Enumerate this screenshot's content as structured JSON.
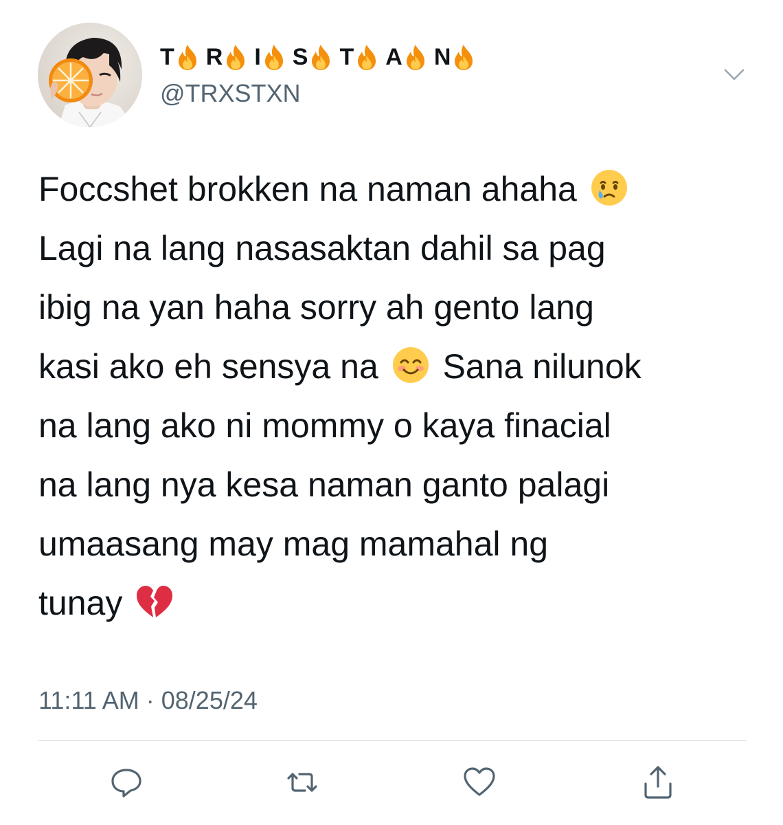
{
  "author": {
    "name_letters": [
      "T",
      "R",
      "I",
      "S",
      "T",
      "A",
      "N"
    ],
    "name_decoration_icon": "fire-icon",
    "handle": "@TRXSTXN",
    "avatar_icon": "avatar-photo"
  },
  "menu": {
    "icon": "chevron-down-icon"
  },
  "tweet": {
    "lines": [
      {
        "segments": [
          {
            "text": "Foccshet brokken na naman ahaha "
          },
          {
            "emoji": "crying-face-icon"
          }
        ]
      },
      {
        "segments": [
          {
            "text": "Lagi na lang nasasaktan dahil sa pag"
          }
        ]
      },
      {
        "segments": [
          {
            "text": "ibig na yan haha sorry ah gento lang"
          }
        ]
      },
      {
        "segments": [
          {
            "text": "kasi ako eh sensya na "
          },
          {
            "emoji": "smiling-face-icon"
          },
          {
            "text": " Sana nilunok"
          }
        ]
      },
      {
        "segments": [
          {
            "text": "na lang ako ni mommy o kaya finacial"
          }
        ]
      },
      {
        "segments": [
          {
            "text": "na lang nya kesa naman ganto palagi"
          }
        ]
      },
      {
        "segments": [
          {
            "text": "umaasang may mag mamahal ng"
          }
        ]
      },
      {
        "segments": [
          {
            "text": "tunay "
          },
          {
            "emoji": "broken-heart-icon"
          }
        ]
      }
    ]
  },
  "meta": {
    "time": "11:11 AM",
    "separator": " · ",
    "date": "08/25/24"
  },
  "actions": [
    {
      "icon": "reply-icon"
    },
    {
      "icon": "retweet-icon"
    },
    {
      "icon": "like-icon"
    },
    {
      "icon": "share-icon"
    }
  ],
  "colors": {
    "text": "#0f1419",
    "secondary": "#536471",
    "divider": "#cfd9de",
    "flame_outer": "#f4900c",
    "flame_inner": "#ffcc4d"
  }
}
